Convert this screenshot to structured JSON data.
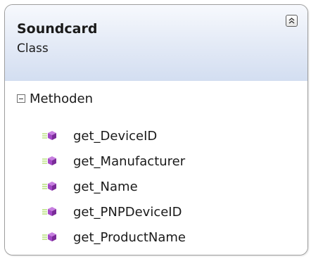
{
  "class_shape": {
    "name": "Soundcard",
    "stereotype": "Class",
    "compartment": {
      "label": "Methoden",
      "methods": [
        "get_DeviceID",
        "get_Manufacturer",
        "get_Name",
        "get_PNPDeviceID",
        "get_ProductName"
      ]
    }
  },
  "icons": {
    "collapse": "double-chevron-up-icon",
    "section_toggle": "minus-box-icon",
    "method": "method-cube-icon"
  },
  "colors": {
    "header_gradient_top": "#f7f9fd",
    "header_gradient_bottom": "#d3def1",
    "method_icon": "#a347c7",
    "border": "#9e9e9e"
  }
}
